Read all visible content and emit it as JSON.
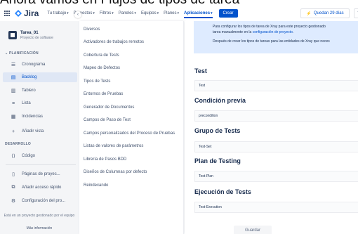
{
  "caption": "Ahora vamos en Flujos de tipos de tarea",
  "nav": {
    "logo": "Jira",
    "items": [
      "Tu trabajo",
      "Proyectos",
      "Filtros",
      "Paneles",
      "Equipos",
      "Planes",
      "Aplicaciones"
    ],
    "active_index": 6,
    "create": "Crear",
    "trial": "Quedan 29 días",
    "help": "?"
  },
  "sidebar": {
    "project_name": "Tarea_01",
    "project_type": "Proyecto de software",
    "planning_label": "PLANIFICACIÓN",
    "planning_items": [
      {
        "label": "Cronograma",
        "icon": "timeline-icon"
      },
      {
        "label": "Backlog",
        "icon": "backlog-icon"
      },
      {
        "label": "Tablero",
        "icon": "board-icon"
      },
      {
        "label": "Lista",
        "icon": "list-icon"
      },
      {
        "label": "Incidencias",
        "icon": "issues-icon"
      },
      {
        "label": "Añadir vista",
        "icon": "add-icon"
      }
    ],
    "dev_label": "DESARROLLO",
    "dev_items": [
      {
        "label": "Código",
        "icon": "code-icon"
      }
    ],
    "extra_items": [
      {
        "label": "Páginas de proyec...",
        "icon": "pages-icon"
      },
      {
        "label": "Añadir acceso rápido",
        "icon": "shortcut-icon"
      },
      {
        "label": "Configuración del pro...",
        "icon": "settings-icon"
      }
    ],
    "footer": "Está en un proyecto gestionado por el equipo",
    "footer_link": "Más información"
  },
  "menu": {
    "items": [
      "Diversos",
      "Activadores de trabajos remotos",
      "Cobertura de Tests",
      "Mapeo de Defectos",
      "Tipos de Tests",
      "Entornos de Pruebas",
      "Generador de Documentos",
      "Campos de Paso de Test",
      "Campos personalizados del Proceso de Pruebas",
      "Listas de valores de parámetros",
      "Librería de Pasos BDD",
      "Diseños de Columnas por defecto",
      "Reindexando"
    ]
  },
  "content": {
    "info_line1": "Para configurar los tipos de tarea de Xray para este proyecto gestionado",
    "info_line2_prefix": "tarea manualmente en la ",
    "info_link": "configuración de proyecto",
    "info_line2_suffix": ".",
    "info_line3": "Después de crear los tipos de tareas para las entidades de Xray que neces",
    "fields": [
      {
        "title": "Test",
        "value": "Test"
      },
      {
        "title": "Condición previa",
        "value": "precondition"
      },
      {
        "title": "Grupo de Tests",
        "value": "Test-Set"
      },
      {
        "title": "Plan de Testing",
        "value": "Test-Plan"
      },
      {
        "title": "Ejecución de Tests",
        "value": "Test-Execution"
      }
    ],
    "save": "Guardar"
  },
  "colors": {
    "primary": "#0052cc",
    "sidebar_bg": "#f4f5f7",
    "active_bg": "#dfe7f5",
    "info_bg": "#deebff"
  }
}
